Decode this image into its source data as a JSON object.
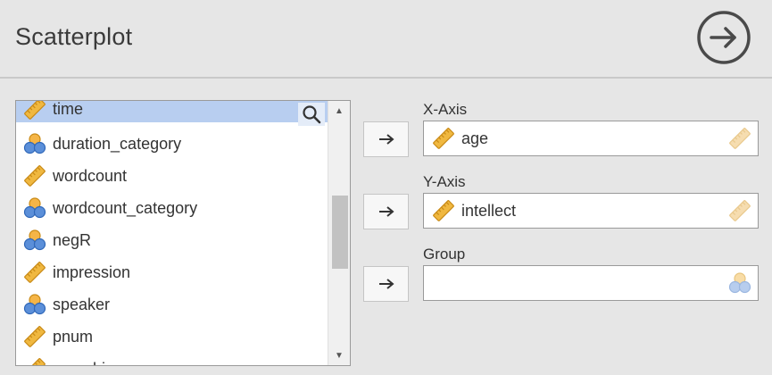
{
  "header": {
    "title": "Scatterplot"
  },
  "variables": [
    {
      "name": "time",
      "type": "continuous",
      "selected": true
    },
    {
      "name": "duration_category",
      "type": "nominal"
    },
    {
      "name": "wordcount",
      "type": "continuous"
    },
    {
      "name": "wordcount_category",
      "type": "nominal"
    },
    {
      "name": "negR",
      "type": "nominal"
    },
    {
      "name": "impression",
      "type": "continuous"
    },
    {
      "name": "speaker",
      "type": "nominal"
    },
    {
      "name": "pnum",
      "type": "continuous"
    },
    {
      "name": "meanhire",
      "type": "continuous"
    }
  ],
  "targets": {
    "xaxis": {
      "label": "X-Axis",
      "value": "age",
      "accepts": "continuous"
    },
    "yaxis": {
      "label": "Y-Axis",
      "value": "intellect",
      "accepts": "continuous"
    },
    "group": {
      "label": "Group",
      "value": "",
      "accepts": "nominal"
    }
  },
  "icons": {
    "go": "circle-arrow-right-icon",
    "search": "search-icon",
    "move": "arrow-right-icon",
    "continuous": "ruler-icon",
    "nominal": "nominal-variable-icon"
  },
  "colors": {
    "background": "#e6e6e6",
    "selection": "#b8cef0",
    "ruler": "#f0b840",
    "nominal_blue": "#5b8fd9",
    "nominal_orange": "#f5b547"
  }
}
